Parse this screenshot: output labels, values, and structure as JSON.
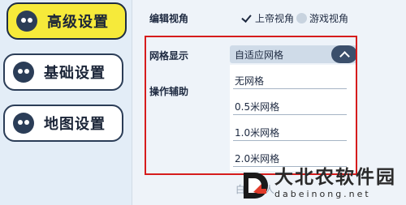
{
  "sidebar": {
    "items": [
      {
        "label": "高级设置",
        "active": true
      },
      {
        "label": "基础设置",
        "active": false
      },
      {
        "label": "地图设置",
        "active": false
      }
    ]
  },
  "settings": {
    "view_label": "编辑视角",
    "view_options": [
      {
        "label": "上帝视角",
        "checked": true
      },
      {
        "label": "游戏视角",
        "checked": false
      }
    ],
    "grid_label": "网格显示",
    "grid_selected": "自适应网格",
    "assist_label": "操作辅助",
    "grid_options": [
      "无网格",
      "0.5米网格",
      "1.0米网格",
      "2.0米网格"
    ],
    "partial_label": "白手回人"
  },
  "colors": {
    "active_menu": "#f6ea3a",
    "highlight_border": "#d61c1c",
    "chevron_bg": "#3b4f6b"
  },
  "watermark": {
    "title": "大北农软件园",
    "url": "dabeinong.net"
  }
}
